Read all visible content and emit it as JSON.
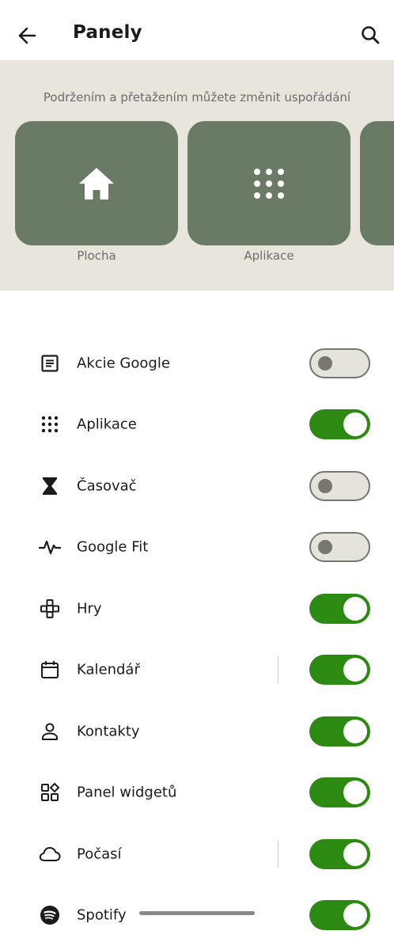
{
  "header": {
    "title": "Panely",
    "back_icon": "arrow-left-icon",
    "search_icon": "search-icon"
  },
  "tray": {
    "hint": "Podržením a přetažením můžete změnit uspořádání",
    "tile_color": "#6a7b65",
    "tiles": [
      {
        "label": "Plocha",
        "icon": "home-icon"
      },
      {
        "label": "Aplikace",
        "icon": "apps-grid-icon"
      },
      {
        "label": "",
        "icon": ""
      }
    ]
  },
  "list": {
    "accent_on": "#2c8a12",
    "items": [
      {
        "label": "Akcie Google",
        "icon": "news-icon",
        "enabled": false
      },
      {
        "label": "Aplikace",
        "icon": "apps-grid-icon",
        "enabled": true
      },
      {
        "label": "Časovač",
        "icon": "hourglass-icon",
        "enabled": false
      },
      {
        "label": "Google Fit",
        "icon": "heartbeat-icon",
        "enabled": false
      },
      {
        "label": "Hry",
        "icon": "gamepad-icon",
        "enabled": true
      },
      {
        "label": "Kalendář",
        "icon": "calendar-icon",
        "enabled": true
      },
      {
        "label": "Kontakty",
        "icon": "person-icon",
        "enabled": true
      },
      {
        "label": "Panel widgetů",
        "icon": "widgets-icon",
        "enabled": true
      },
      {
        "label": "Počasí",
        "icon": "cloud-icon",
        "enabled": true
      },
      {
        "label": "Spotify",
        "icon": "spotify-icon",
        "enabled": true
      }
    ]
  }
}
